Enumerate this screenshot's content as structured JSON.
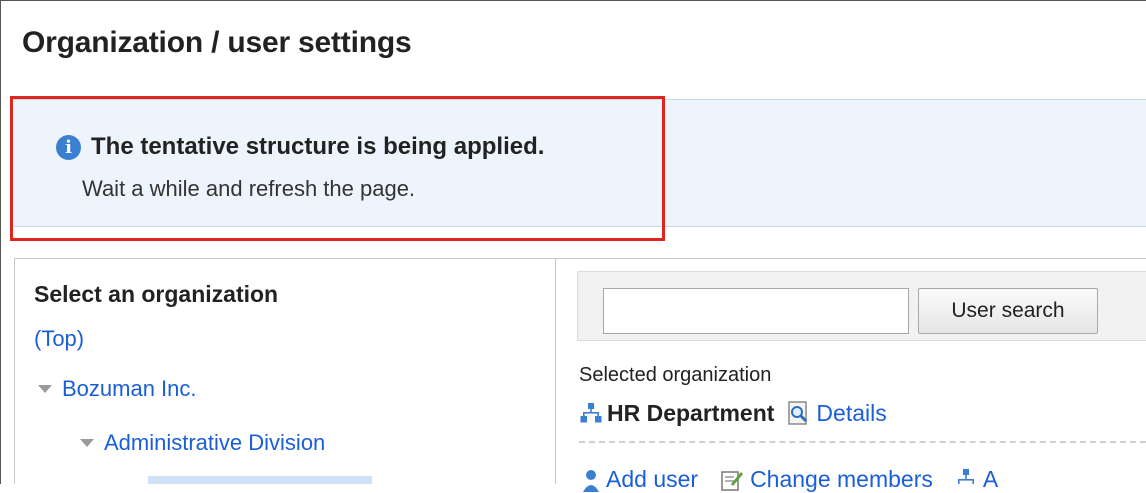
{
  "page_title": "Organization / user settings",
  "notice": {
    "icon": "info-icon",
    "title": "The tentative structure is being applied.",
    "body": "Wait a while and refresh the page."
  },
  "left_panel": {
    "heading": "Select an organization",
    "top_link": "(Top)",
    "tree": [
      {
        "label": "Bozuman Inc.",
        "expanded": true
      },
      {
        "label": "Administrative Division",
        "expanded": true
      }
    ]
  },
  "right_panel": {
    "search": {
      "value": "",
      "button_label": "User search"
    },
    "selected_org_label": "Selected organization",
    "org_name": "HR Department",
    "details_label": "Details",
    "actions": [
      {
        "label": "Add user",
        "icon": "user-icon"
      },
      {
        "label": "Change members",
        "icon": "edit-icon"
      },
      {
        "label": "A",
        "icon": "org-tree-icon"
      }
    ]
  },
  "colors": {
    "notice_bg": "#edf4fc",
    "highlight": "#e0251e",
    "link": "#1a5fd6",
    "info_icon": "#3b7fd1"
  }
}
